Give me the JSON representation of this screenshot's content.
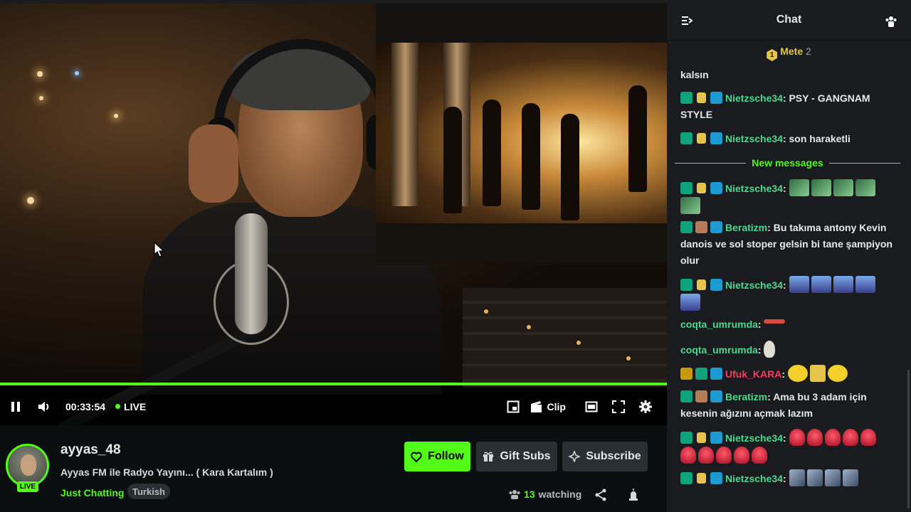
{
  "player": {
    "time": "00:33:54",
    "live_label": "LIVE",
    "clip_label": "Clip",
    "progress_fraction": 1.0,
    "accent": "#53fc18"
  },
  "channel": {
    "name": "ayyas_48",
    "title": "Ayyas FM ile Radyo Yayını... ( Kara Kartalım )",
    "category": "Just Chatting",
    "tag": "Turkish",
    "live_badge": "LIVE",
    "watching_count": "13",
    "watching_label": "watching"
  },
  "actions": {
    "follow": "Follow",
    "gift": "Gift Subs",
    "subscribe": "Subscribe"
  },
  "chat": {
    "title": "Chat",
    "pinned_user": "Mete",
    "pinned_count": "2",
    "pinned_rank": "1",
    "new_messages_label": "New messages",
    "messages": [
      {
        "user": "",
        "text": "kalsın"
      },
      {
        "user": "Nietzsche34",
        "text": "PSY - GANGNAM STYLE"
      },
      {
        "user": "Nietzsche34",
        "text": "son haraketli"
      },
      {
        "user": "Nietzsche34",
        "text": ""
      },
      {
        "user": "Beratizm",
        "text": "Bu takıma antony Kevin danois ve sol stoper gelsin bi tane şampiyon olur"
      },
      {
        "user": "Nietzsche34",
        "text": ""
      },
      {
        "user": "coqta_umrumda",
        "text": ""
      },
      {
        "user": "coqta_umrumda",
        "text": ""
      },
      {
        "user": "Ufuk_KARA",
        "text": ""
      },
      {
        "user": "Beratizm",
        "text": "Ama bu 3 adam için kesenin ağızını açmak lazım"
      },
      {
        "user": "Nietzsche34",
        "text": ""
      },
      {
        "user": "Nietzsche34",
        "text": ""
      }
    ],
    "colors": {
      "username": "#4bd98f",
      "username_alt": "#ff3b5c",
      "pinned": "#e5c44a"
    }
  },
  "icons": {
    "pause": "pause-icon",
    "volume": "volume-icon",
    "clip": "clip-icon",
    "theater": "theater-icon",
    "fullscreen": "fullscreen-icon",
    "settings": "gear-icon",
    "pip": "pip-icon"
  }
}
